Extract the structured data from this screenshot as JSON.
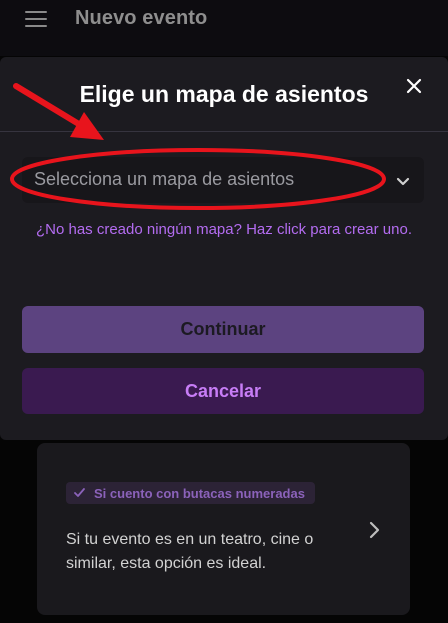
{
  "header": {
    "title": "Nuevo evento",
    "menu_icon": "hamburger-menu-icon"
  },
  "modal": {
    "title": "Elige un mapa de asientos",
    "close_icon": "close-icon",
    "select": {
      "placeholder": "Selecciona un mapa de asientos",
      "chevron_icon": "chevron-down-icon"
    },
    "create_link": "¿No has creado ningún mapa? Haz click para crear uno.",
    "continue_label": "Continuar",
    "cancel_label": "Cancelar"
  },
  "background_card": {
    "badge": "Si cuento con butacas numeradas",
    "badge_icon": "check-icon",
    "description": "Si tu evento es en un teatro, cine o similar, esta opción es ideal.",
    "chevron_icon": "chevron-right-icon"
  },
  "colors": {
    "accent": "#b36cf0",
    "annotation": "#e8141c",
    "modal_bg": "#1c1b20",
    "continue_bg": "#5c4380",
    "cancel_bg": "#3a1a50"
  }
}
